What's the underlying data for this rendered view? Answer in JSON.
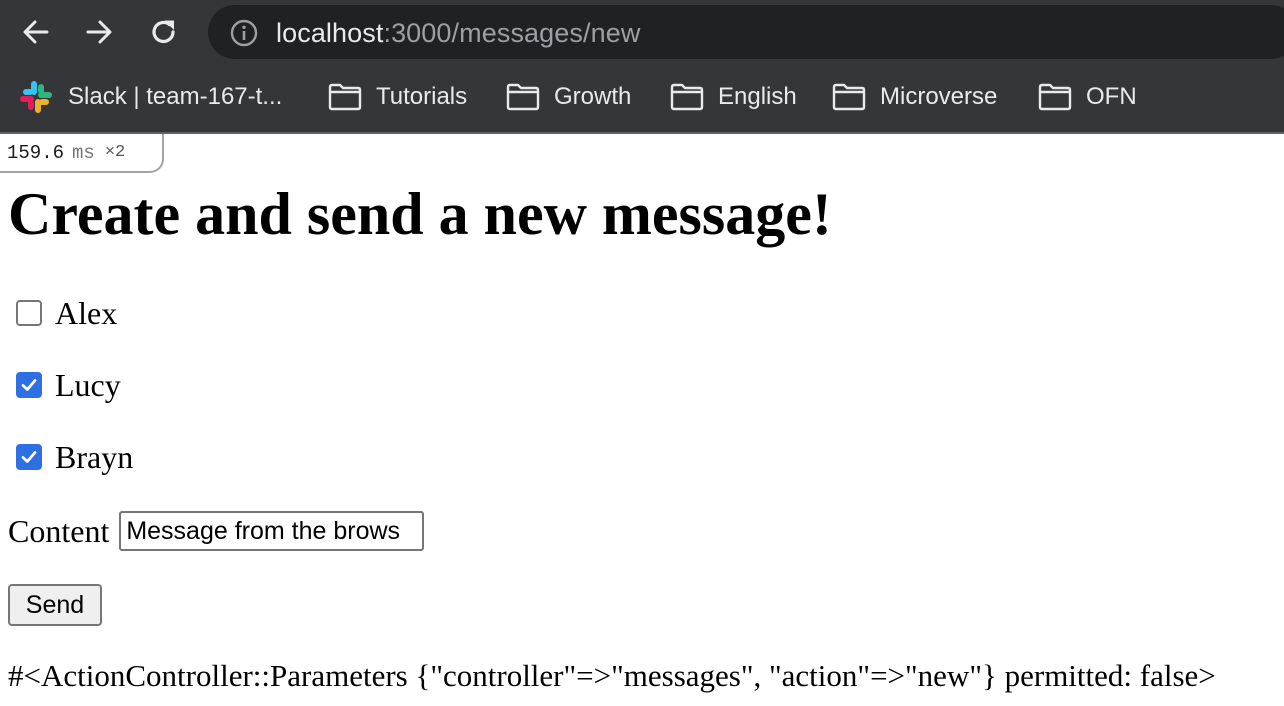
{
  "browser": {
    "url_host": "localhost",
    "url_path": ":3000/messages/new",
    "bookmarks": [
      {
        "label": "Slack | team-167-t...",
        "icon": "slack-icon"
      },
      {
        "label": "Tutorials",
        "icon": "folder-icon"
      },
      {
        "label": "Growth",
        "icon": "folder-icon"
      },
      {
        "label": "English",
        "icon": "folder-icon"
      },
      {
        "label": "Microverse",
        "icon": "folder-icon"
      },
      {
        "label": "OFN",
        "icon": "folder-icon"
      }
    ]
  },
  "profiler": {
    "time": "159.6",
    "unit": "ms",
    "count": "×2"
  },
  "page": {
    "title": "Create and send a new message!",
    "recipients": [
      {
        "name": "Alex",
        "checked": false
      },
      {
        "name": "Lucy",
        "checked": true
      },
      {
        "name": "Brayn",
        "checked": true
      }
    ],
    "content_label": "Content",
    "content_value": "Message from the brows",
    "send_label": "Send",
    "params_text": "#<ActionController::Parameters {\"controller\"=>\"messages\", \"action\"=>\"new\"} permitted: false>"
  },
  "colors": {
    "chrome_bg": "#35363a",
    "omnibox_bg": "#202124",
    "checkbox_accent": "#2f6fe4"
  }
}
